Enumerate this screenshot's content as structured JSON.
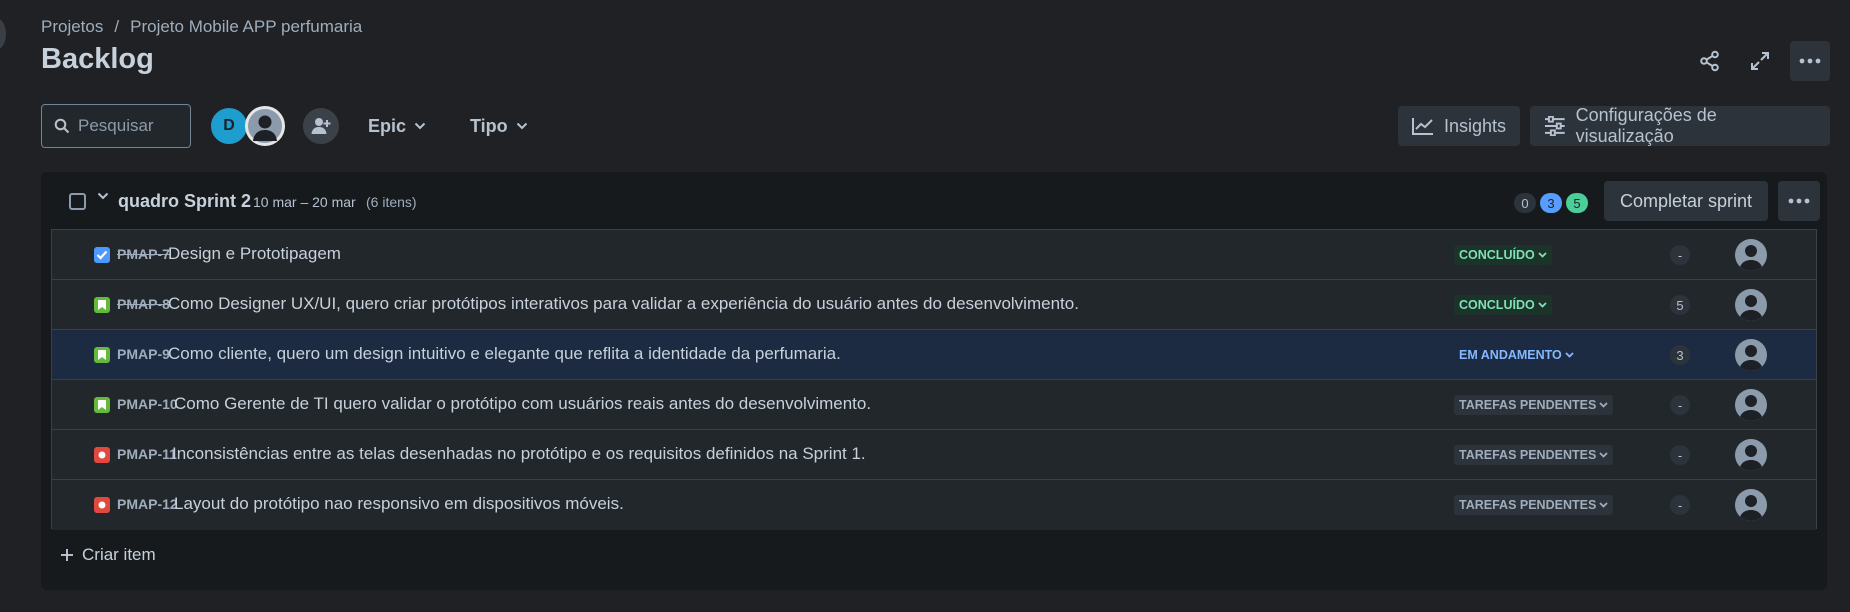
{
  "breadcrumb": {
    "root": "Projetos",
    "separator": "/",
    "project": "Projeto Mobile APP perfumaria"
  },
  "page_title": "Backlog",
  "header_icons": [
    "share-icon",
    "expand-icon",
    "more-icon"
  ],
  "toolbar": {
    "search_placeholder": "Pesquisar",
    "avatar_initial": "D",
    "filters": [
      {
        "label": "Epic"
      },
      {
        "label": "Tipo"
      }
    ],
    "insights_label": "Insights",
    "view_settings_label": "Configurações de visualização"
  },
  "sprint": {
    "title": "quadro Sprint 2",
    "dates": "10 mar – 20 mar",
    "count": "(6 itens)",
    "pills": {
      "todo": "0",
      "in_progress": "3",
      "done": "5"
    },
    "complete_label": "Completar sprint",
    "create_label": "Criar item",
    "items": [
      {
        "type": "task",
        "key": "PMAP-7",
        "done": true,
        "summary": "Design e Prototipagem",
        "status": "CONCLUÍDO",
        "status_kind": "done",
        "estimate": "-"
      },
      {
        "type": "story",
        "key": "PMAP-8",
        "done": true,
        "summary": "Como Designer UX/UI, quero criar protótipos interativos para validar a experiência do usuário antes do desenvolvimento.",
        "status": "CONCLUÍDO",
        "status_kind": "done",
        "estimate": "5"
      },
      {
        "type": "story",
        "key": "PMAP-9",
        "done": false,
        "summary": "Como cliente, quero um design intuitivo e elegante que reflita a identidade da perfumaria.",
        "status": "EM ANDAMENTO",
        "status_kind": "prog",
        "estimate": "3"
      },
      {
        "type": "story",
        "key": "PMAP-10",
        "done": false,
        "summary": "Como Gerente de TI quero validar o protótipo com usuários reais antes do desenvolvimento.",
        "status": "TAREFAS PENDENTES",
        "status_kind": "todo",
        "estimate": "-"
      },
      {
        "type": "bug",
        "key": "PMAP-11",
        "done": false,
        "summary": "Inconsistências entre as telas desenhadas no protótipo e os requisitos definidos na Sprint 1.",
        "status": "TAREFAS PENDENTES",
        "status_kind": "todo",
        "estimate": "-"
      },
      {
        "type": "bug",
        "key": "PMAP-12",
        "done": false,
        "summary": "Layout do protótipo nao responsivo em dispositivos móveis.",
        "status": "TAREFAS PENDENTES",
        "status_kind": "todo",
        "estimate": "-"
      }
    ]
  },
  "colors": {
    "background": "#1f2124",
    "panel": "#161a1d",
    "row": "#22272b",
    "row_selected": "#1c2b41",
    "accent_blue": "#579dff",
    "done_green": "#4bce97",
    "bug_red": "#e2483d",
    "story_green": "#63ba3c"
  }
}
